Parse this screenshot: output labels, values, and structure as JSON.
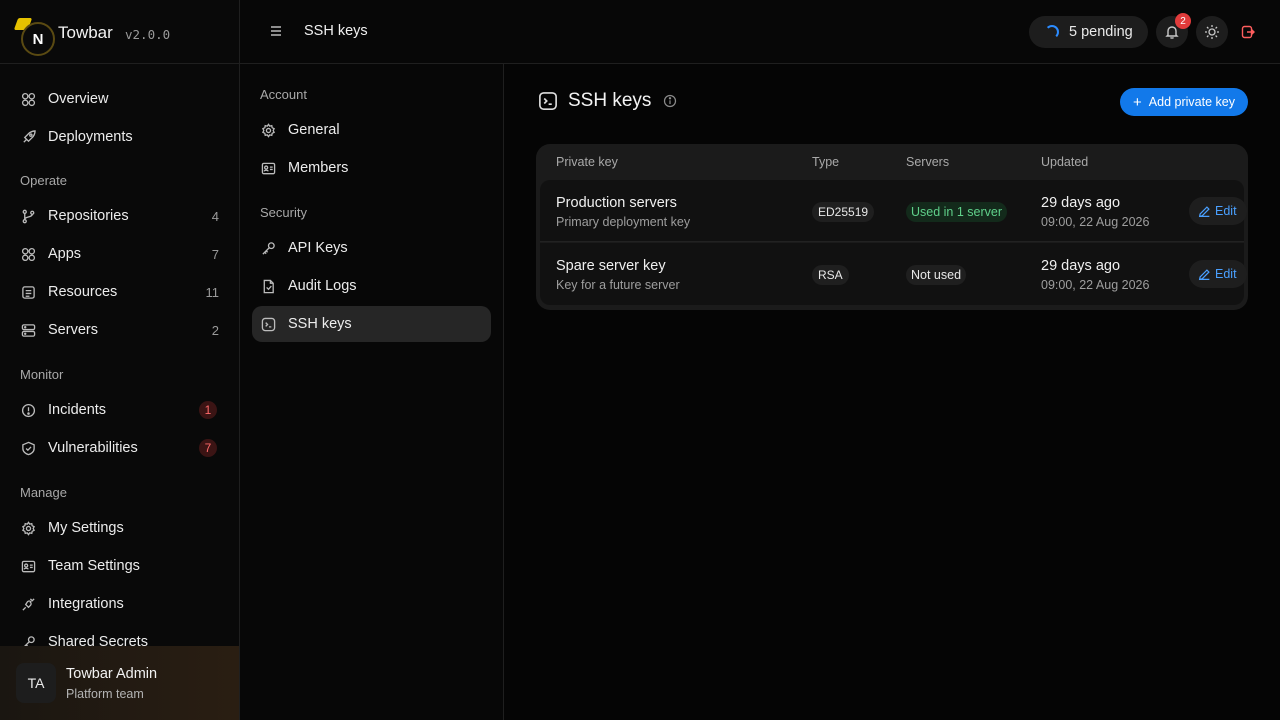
{
  "brand": {
    "name": "Towbar",
    "version": "v2.0.0",
    "logo_letter": "N"
  },
  "sidebar": {
    "top_items": [
      {
        "label": "Overview",
        "icon": "grid-icon"
      },
      {
        "label": "Deployments",
        "icon": "rocket-icon"
      }
    ],
    "groups": [
      {
        "title": "Operate",
        "items": [
          {
            "label": "Repositories",
            "count": "4",
            "icon": "git-branch-icon"
          },
          {
            "label": "Apps",
            "count": "7",
            "icon": "grid-icon"
          },
          {
            "label": "Resources",
            "count": "11",
            "icon": "database-icon"
          },
          {
            "label": "Servers",
            "count": "2",
            "icon": "server-icon"
          }
        ]
      },
      {
        "title": "Monitor",
        "items": [
          {
            "label": "Incidents",
            "count": "1",
            "icon": "alert-circle-icon"
          },
          {
            "label": "Vulnerabilities",
            "count": "7",
            "icon": "shield-icon"
          }
        ]
      },
      {
        "title": "Manage",
        "items": [
          {
            "label": "My Settings",
            "icon": "gear-icon"
          },
          {
            "label": "Team Settings",
            "icon": "id-card-icon"
          },
          {
            "label": "Integrations",
            "icon": "plug-icon"
          },
          {
            "label": "Shared Secrets",
            "icon": "key-icon"
          }
        ]
      }
    ],
    "user": {
      "initials": "TA",
      "name": "Towbar Admin",
      "team": "Platform team"
    }
  },
  "topbar": {
    "title": "SSH keys",
    "pending_label": "5 pending",
    "notification_count": "2",
    "colors": {
      "accent": "#1279ea",
      "danger": "#e13b3b",
      "success": "#5fd08a"
    }
  },
  "subnav": {
    "groups": [
      {
        "title": "Account",
        "items": [
          {
            "label": "General",
            "icon": "gear-icon"
          },
          {
            "label": "Members",
            "icon": "id-card-icon"
          }
        ]
      },
      {
        "title": "Security",
        "items": [
          {
            "label": "API Keys",
            "icon": "key-icon"
          },
          {
            "label": "Audit Logs",
            "icon": "file-icon"
          },
          {
            "label": "SSH keys",
            "icon": "terminal-icon",
            "active": true
          }
        ]
      }
    ]
  },
  "main": {
    "title": "SSH keys",
    "add_button": "Add private key",
    "table": {
      "headers": [
        "Private key",
        "Type",
        "Servers",
        "Updated"
      ],
      "rows": [
        {
          "name": "Production servers",
          "description": "Primary deployment key",
          "type": "ED25519",
          "servers": "Used in 1 server",
          "servers_state": "used",
          "updated_relative": "29 days ago",
          "updated_absolute": "09:00, 22 Aug 2026",
          "action": "Edit"
        },
        {
          "name": "Spare server key",
          "description": "Key for a future server",
          "type": "RSA",
          "servers": "Not used",
          "servers_state": "unused",
          "updated_relative": "29 days ago",
          "updated_absolute": "09:00, 22 Aug 2026",
          "action": "Edit"
        }
      ]
    }
  }
}
